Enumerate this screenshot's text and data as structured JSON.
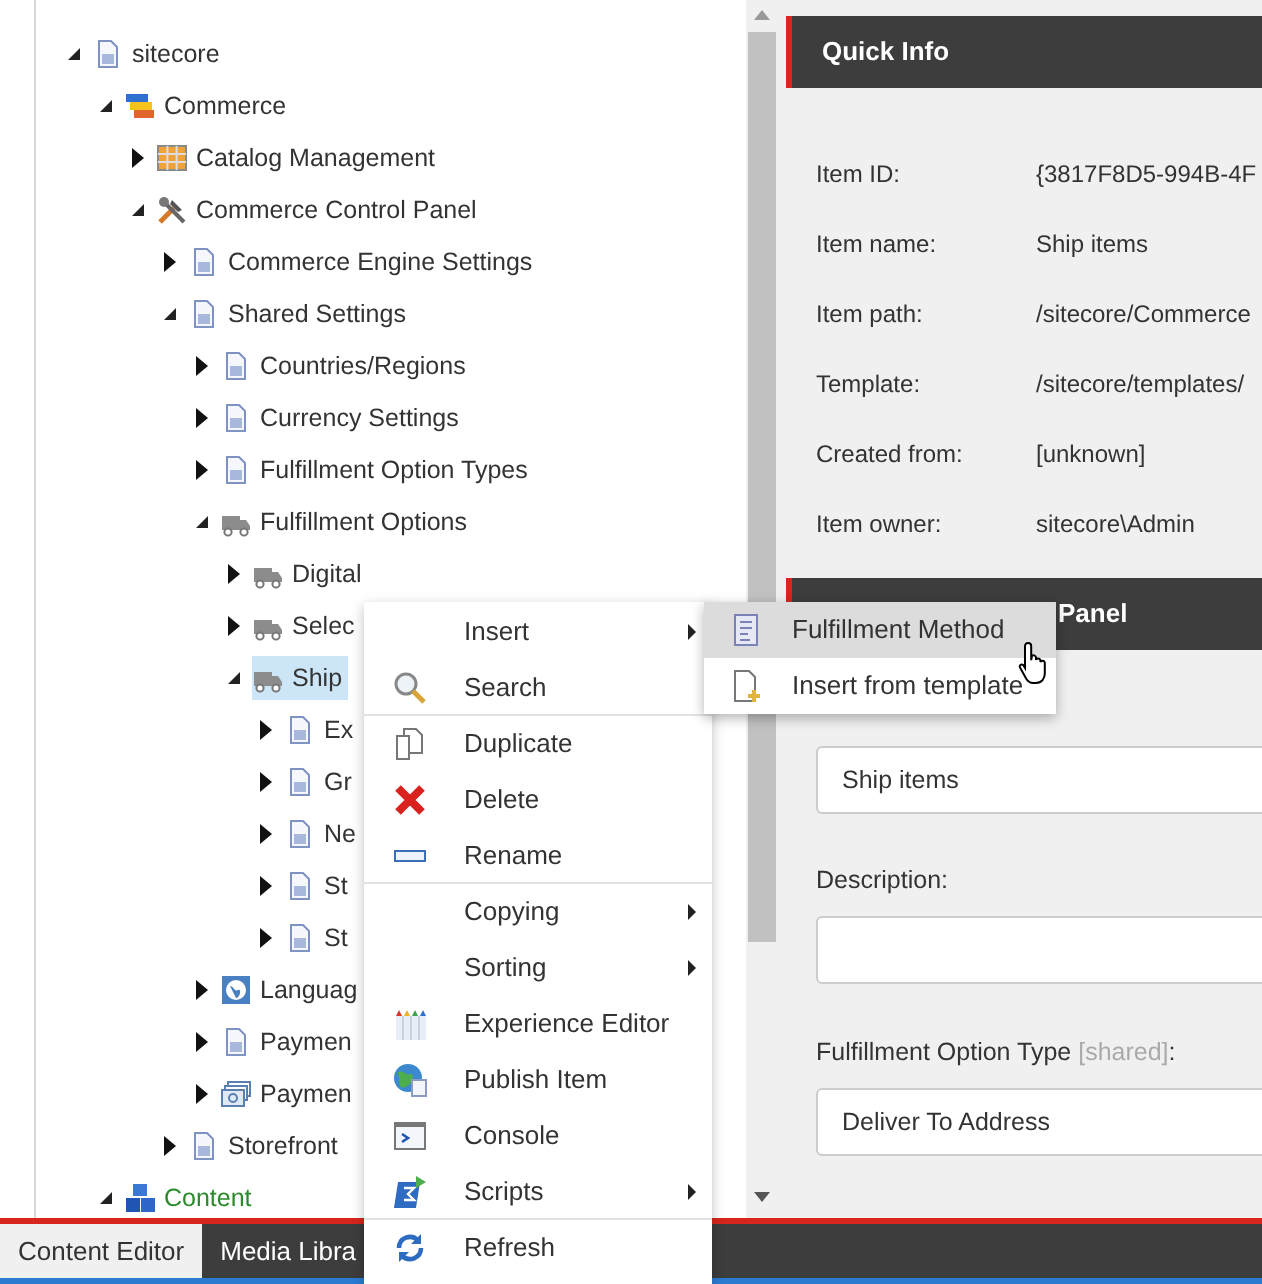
{
  "tree": [
    {
      "label": "sitecore",
      "kind": "page",
      "expanded": true,
      "selected": false,
      "children": [
        {
          "label": "Commerce",
          "kind": "commerce",
          "expanded": true,
          "selected": false,
          "children": [
            {
              "label": "Catalog Management",
              "kind": "catalog",
              "expanded": false,
              "selected": false
            },
            {
              "label": "Commerce Control Panel",
              "kind": "tools",
              "expanded": true,
              "selected": false,
              "children": [
                {
                  "label": "Commerce Engine Settings",
                  "kind": "page",
                  "expanded": false,
                  "selected": false
                },
                {
                  "label": "Shared Settings",
                  "kind": "page",
                  "expanded": true,
                  "selected": false,
                  "children": [
                    {
                      "label": "Countries/Regions",
                      "kind": "page",
                      "expanded": false,
                      "selected": false
                    },
                    {
                      "label": "Currency Settings",
                      "kind": "page",
                      "expanded": false,
                      "selected": false
                    },
                    {
                      "label": "Fulfillment Option Types",
                      "kind": "page",
                      "expanded": false,
                      "selected": false
                    },
                    {
                      "label": "Fulfillment Options",
                      "kind": "truck",
                      "expanded": true,
                      "selected": false,
                      "children": [
                        {
                          "label": "Digital",
                          "kind": "truck",
                          "expanded": false,
                          "selected": false
                        },
                        {
                          "label": "Selec",
                          "kind": "truck",
                          "expanded": false,
                          "selected": false
                        },
                        {
                          "label": "Ship",
                          "kind": "truck",
                          "expanded": true,
                          "selected": true,
                          "children": [
                            {
                              "label": "Ex",
                              "kind": "page",
                              "expanded": false,
                              "selected": false
                            },
                            {
                              "label": "Gr",
                              "kind": "page",
                              "expanded": false,
                              "selected": false
                            },
                            {
                              "label": "Ne",
                              "kind": "page",
                              "expanded": false,
                              "selected": false
                            },
                            {
                              "label": "St",
                              "kind": "page",
                              "expanded": false,
                              "selected": false
                            },
                            {
                              "label": "St",
                              "kind": "page",
                              "expanded": false,
                              "selected": false
                            }
                          ]
                        }
                      ]
                    },
                    {
                      "label": "Languag",
                      "kind": "language",
                      "expanded": false,
                      "selected": false
                    },
                    {
                      "label": "Paymen",
                      "kind": "page",
                      "expanded": false,
                      "selected": false
                    },
                    {
                      "label": "Paymen",
                      "kind": "payment",
                      "expanded": false,
                      "selected": false
                    }
                  ]
                },
                {
                  "label": "Storefront",
                  "kind": "page",
                  "expanded": false,
                  "selected": false
                }
              ]
            }
          ]
        },
        {
          "label": "Content",
          "kind": "content",
          "expanded": true,
          "selected": false
        }
      ]
    }
  ],
  "quick_info": {
    "title": "Quick Info",
    "rows": [
      {
        "label": "Item ID:",
        "value": "{3817F8D5-994B-4F"
      },
      {
        "label": "Item name:",
        "value": "Ship items"
      },
      {
        "label": "Item path:",
        "value": "/sitecore/Commerce"
      },
      {
        "label": "Template:",
        "value": "/sitecore/templates/"
      },
      {
        "label": "Created from:",
        "value": "[unknown]"
      },
      {
        "label": "Item owner:",
        "value": "sitecore\\Admin"
      }
    ]
  },
  "section": {
    "title": "Panel",
    "fields": [
      {
        "value": "Ship items"
      },
      {
        "label": "Description:"
      },
      {
        "label": "Fulfillment Option Type",
        "note": "[shared]",
        "suffix": ":",
        "value": "Deliver To Address"
      }
    ]
  },
  "context_menu": {
    "items": [
      {
        "label": "Insert",
        "kind": "submenu",
        "separated": false
      },
      {
        "label": "Search",
        "kind": "command",
        "separated": false
      },
      {
        "label": "Duplicate",
        "kind": "command",
        "separated": true
      },
      {
        "label": "Delete",
        "kind": "command",
        "separated": false
      },
      {
        "label": "Rename",
        "kind": "command",
        "separated": false
      },
      {
        "label": "Copying",
        "kind": "submenu",
        "separated": true
      },
      {
        "label": "Sorting",
        "kind": "submenu",
        "separated": false
      },
      {
        "label": "Experience Editor",
        "kind": "command",
        "separated": false
      },
      {
        "label": "Publish Item",
        "kind": "command",
        "separated": false
      },
      {
        "label": "Console",
        "kind": "command",
        "separated": false
      },
      {
        "label": "Scripts",
        "kind": "submenu",
        "separated": false
      },
      {
        "label": "Refresh",
        "kind": "command",
        "separated": true
      }
    ]
  },
  "submenu": {
    "items": [
      {
        "label": "Fulfillment Method",
        "selected": true
      },
      {
        "label": "Insert from template",
        "selected": false
      }
    ]
  },
  "bottom_tabs": [
    {
      "label": "Content Editor",
      "selected": true
    },
    {
      "label": "Media Libra",
      "selected": false
    }
  ]
}
